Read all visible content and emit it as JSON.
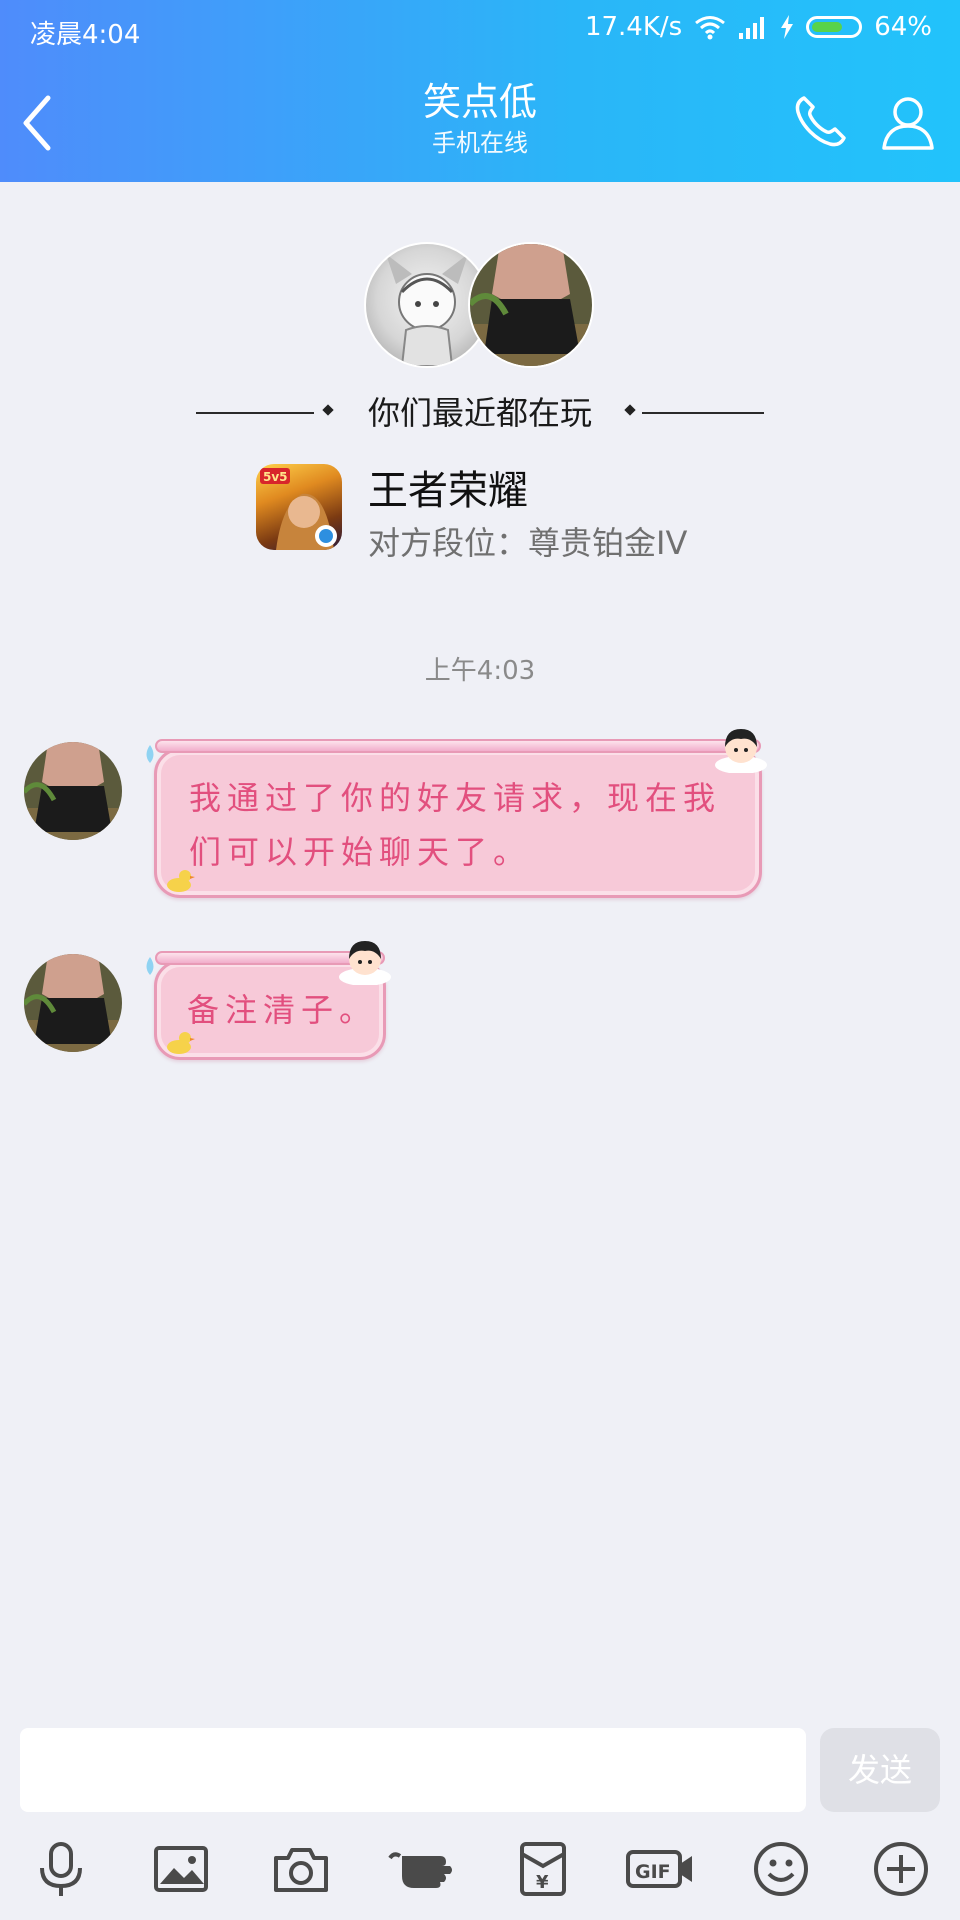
{
  "status_bar": {
    "time": "凌晨4:04",
    "net_speed": "17.4K/s",
    "battery": "64%"
  },
  "header": {
    "title": "笑点低",
    "subtitle": "手机在线"
  },
  "play_card": {
    "heading": "你们最近都在玩",
    "game_name": "王者荣耀",
    "rank_text": "对方段位：尊贵铂金IV"
  },
  "chat": {
    "timestamp": "上午4:03",
    "messages": [
      {
        "line1": "我通过了你的好友请求，现在我",
        "line2": "们可以开始聊天了。"
      },
      {
        "line1": "备注清子。"
      }
    ]
  },
  "composer": {
    "send_label": "发送"
  },
  "toolbar": [
    "microphone-icon",
    "image-icon",
    "camera-icon",
    "poke-icon",
    "red-packet-icon",
    "gif-icon",
    "emoji-icon",
    "plus-icon"
  ],
  "colors": {
    "header_start": "#4f8cfb",
    "header_end": "#22c3fb",
    "bubble": "#f7c9d8",
    "bubble_text": "#e24f7e"
  }
}
